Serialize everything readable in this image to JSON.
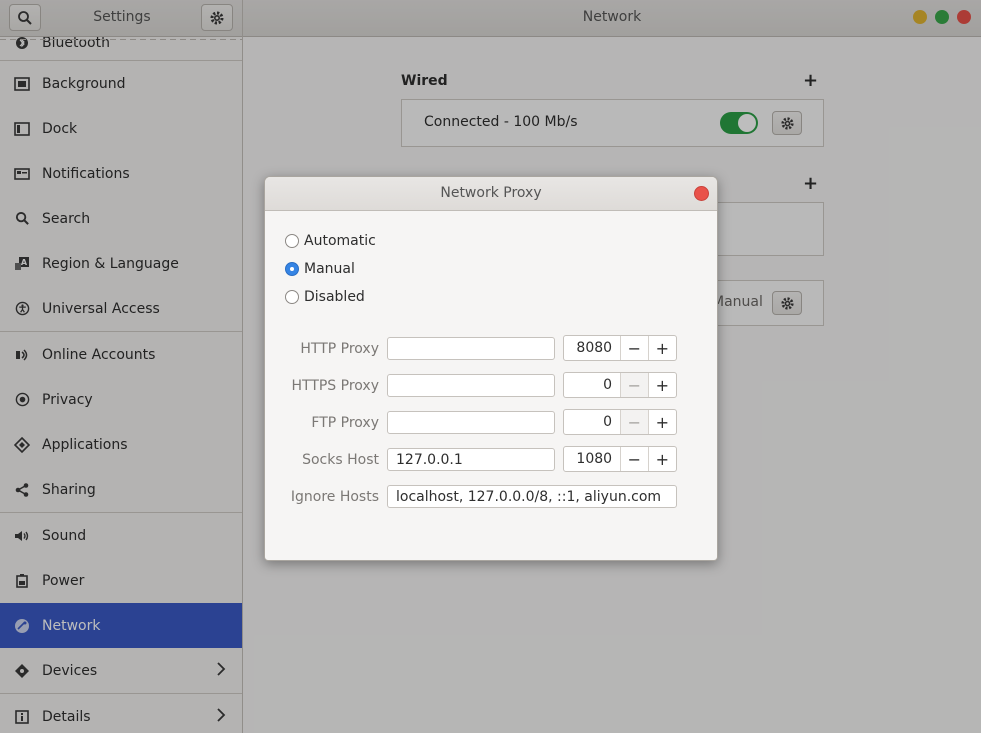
{
  "header": {
    "left_title": "Settings",
    "main_title": "Network",
    "search_icon": "search-icon",
    "menu_icon": "gear-icon",
    "controls": {
      "minimize_color": "#e0b431",
      "maximize_color": "#3aa84b",
      "close_color": "#e9524a"
    }
  },
  "sidebar": {
    "items": [
      {
        "label": "Bluetooth",
        "icon": "bluetooth-icon"
      },
      {
        "label": "Background",
        "icon": "background-icon"
      },
      {
        "label": "Dock",
        "icon": "dock-icon"
      },
      {
        "label": "Notifications",
        "icon": "notifications-icon"
      },
      {
        "label": "Search",
        "icon": "search-icon"
      },
      {
        "label": "Region & Language",
        "icon": "region-icon"
      },
      {
        "label": "Universal Access",
        "icon": "accessibility-icon"
      },
      {
        "label": "Online Accounts",
        "icon": "online-accounts-icon"
      },
      {
        "label": "Privacy",
        "icon": "privacy-icon"
      },
      {
        "label": "Applications",
        "icon": "applications-icon"
      },
      {
        "label": "Sharing",
        "icon": "share-icon"
      },
      {
        "label": "Sound",
        "icon": "sound-icon"
      },
      {
        "label": "Power",
        "icon": "power-icon"
      },
      {
        "label": "Network",
        "icon": "network-icon",
        "active": true
      },
      {
        "label": "Devices",
        "icon": "devices-icon"
      },
      {
        "label": "Details",
        "icon": "details-icon"
      }
    ],
    "active_color": "#3b59c5"
  },
  "network": {
    "wired_title": "Wired",
    "wired_add": "+",
    "wired_status": "Connected - 100 Mb/s",
    "wired_enabled": true,
    "vpn_add": "+",
    "proxy_mode_value": "Manual"
  },
  "proxy_dialog": {
    "title": "Network Proxy",
    "modes": [
      {
        "label": "Automatic",
        "selected": false
      },
      {
        "label": "Manual",
        "selected": true
      },
      {
        "label": "Disabled",
        "selected": false
      }
    ],
    "rows": {
      "http": {
        "label": "HTTP Proxy",
        "host": "",
        "port": "8080"
      },
      "https": {
        "label": "HTTPS Proxy",
        "host": "",
        "port": "0"
      },
      "ftp": {
        "label": "FTP Proxy",
        "host": "",
        "port": "0"
      },
      "socks": {
        "label": "Socks Host",
        "host": "127.0.0.1",
        "port": "1080"
      }
    },
    "ignore": {
      "label": "Ignore Hosts",
      "value": "localhost, 127.0.0.0/8, ::1, aliyun.com"
    },
    "minus": "−",
    "plus": "+"
  }
}
